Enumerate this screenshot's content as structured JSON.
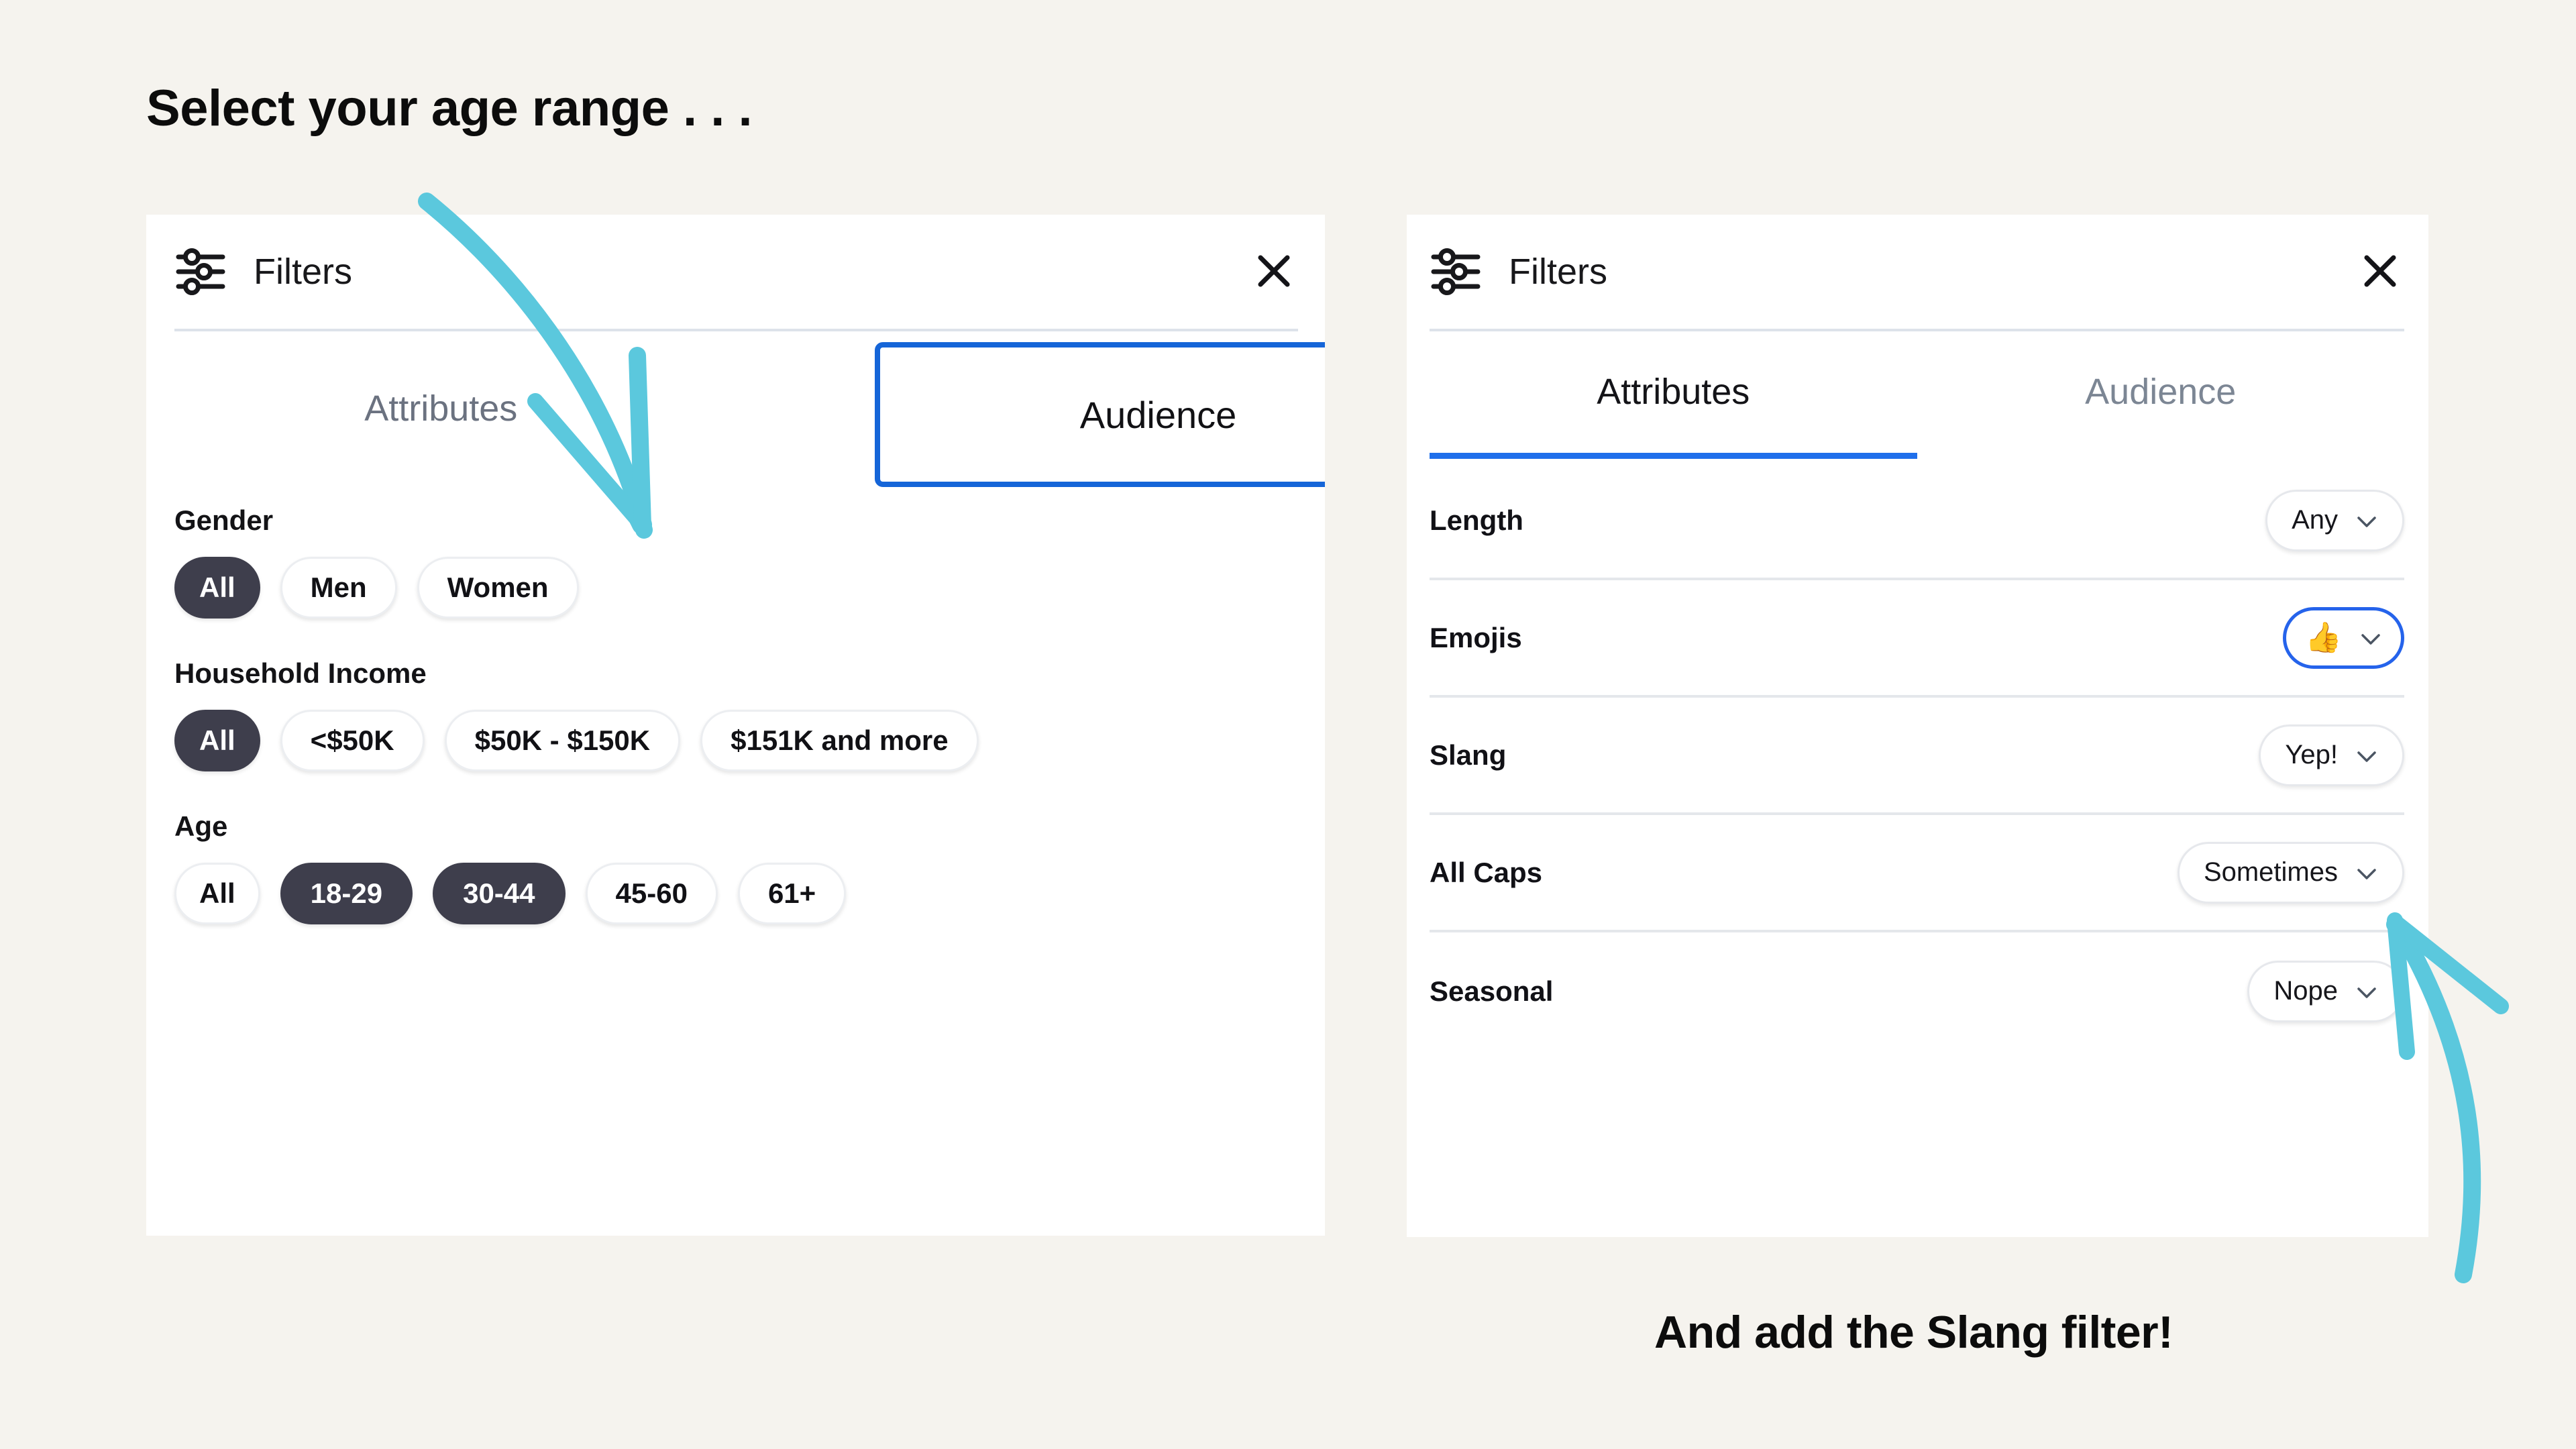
{
  "captions": {
    "top": "Select your age range . . .",
    "bottom": "And add the Slang filter!"
  },
  "colors": {
    "page_background": "#f5f3ee",
    "panel_background": "#ffffff",
    "accent_blue": "#1f6feb",
    "focus_blue": "#1565d8",
    "selected_pill": "#3e3e4c",
    "arrow_cyan": "#5bc8dd",
    "muted_text": "#6b7280",
    "divider": "#e4e7eb"
  },
  "left_panel": {
    "icon": "filter-sliders-icon",
    "title": "Filters",
    "close_icon": "close-icon",
    "tabs": [
      {
        "label": "Attributes",
        "active": false,
        "style": "plain"
      },
      {
        "label": "Audience",
        "active": true,
        "style": "boxed"
      }
    ],
    "groups": [
      {
        "label": "Gender",
        "options": [
          {
            "label": "All",
            "selected": true
          },
          {
            "label": "Men",
            "selected": false
          },
          {
            "label": "Women",
            "selected": false
          }
        ]
      },
      {
        "label": "Household Income",
        "options": [
          {
            "label": "All",
            "selected": true
          },
          {
            "label": "<$50K",
            "selected": false
          },
          {
            "label": "$50K - $150K",
            "selected": false
          },
          {
            "label": "$151K and more",
            "selected": false
          }
        ]
      },
      {
        "label": "Age",
        "options": [
          {
            "label": "All",
            "selected": false
          },
          {
            "label": "18-29",
            "selected": true
          },
          {
            "label": "30-44",
            "selected": true
          },
          {
            "label": "45-60",
            "selected": false
          },
          {
            "label": "61+",
            "selected": false
          }
        ]
      }
    ]
  },
  "right_panel": {
    "icon": "filter-sliders-icon",
    "title": "Filters",
    "close_icon": "close-icon",
    "tabs": [
      {
        "label": "Attributes",
        "active": true
      },
      {
        "label": "Audience",
        "active": false
      }
    ],
    "rows": [
      {
        "label": "Length",
        "value": "Any",
        "emoji": "",
        "focused": false
      },
      {
        "label": "Emojis",
        "value": "",
        "emoji": "👍",
        "focused": true
      },
      {
        "label": "Slang",
        "value": "Yep!",
        "emoji": "",
        "focused": false
      },
      {
        "label": "All Caps",
        "value": "Sometimes",
        "emoji": "",
        "focused": false
      },
      {
        "label": "Seasonal",
        "value": "Nope",
        "emoji": "",
        "focused": false
      }
    ]
  },
  "annotations": [
    {
      "name": "arrow-to-audience-tab",
      "direction": "down",
      "color": "#5bc8dd"
    },
    {
      "name": "arrow-to-slang-row",
      "direction": "up-left",
      "color": "#5bc8dd"
    }
  ]
}
